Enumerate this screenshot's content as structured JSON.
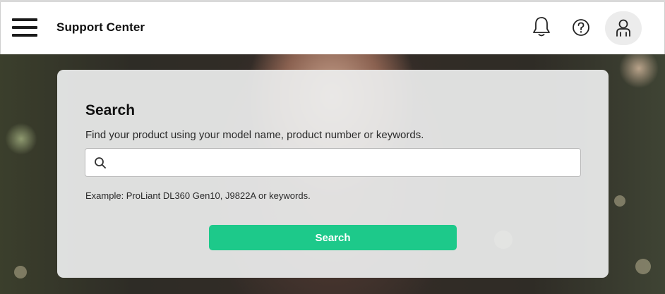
{
  "header": {
    "title": "Support Center",
    "icons": {
      "menu": "hamburger-menu-icon",
      "notifications": "bell-icon",
      "help": "help-icon",
      "account": "user-icon"
    }
  },
  "search_card": {
    "title": "Search",
    "description": "Find your product using your model name, product number or keywords.",
    "input_value": "",
    "input_placeholder": "",
    "example": "Example: ProLiant DL360 Gen10, J9822A or keywords.",
    "button_label": "Search"
  },
  "colors": {
    "accent": "#1dc98a",
    "card_bg": "#ecedee",
    "header_bg": "#ffffff",
    "text": "#111111"
  }
}
